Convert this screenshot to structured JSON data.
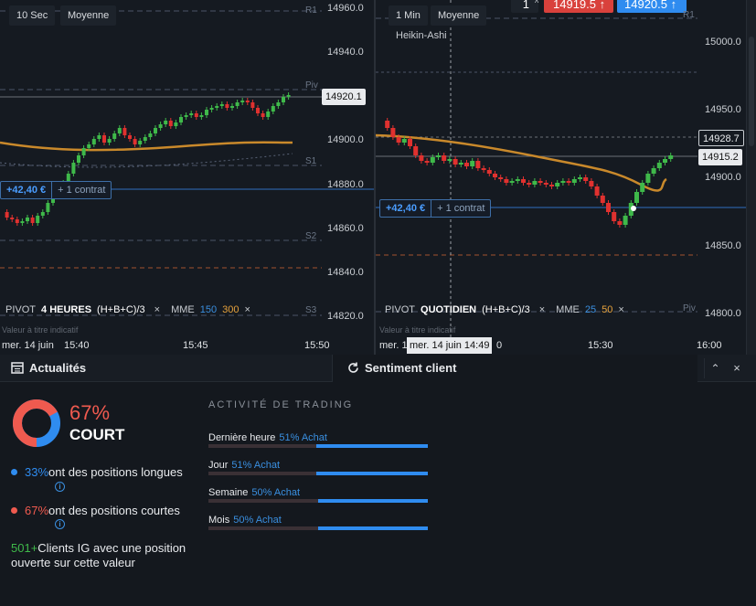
{
  "left_chart": {
    "interval": "10 Sec",
    "type": "Moyenne",
    "price_axis": [
      "14960.0",
      "14940.0",
      "14920.1",
      "14900.0",
      "14880.0",
      "14860.0",
      "14840.0",
      "14820.0"
    ],
    "current_price": "14920.1",
    "levels": {
      "r1": "R1",
      "piv": "Piv",
      "s1": "S1",
      "s2": "S2",
      "s3": "S3"
    },
    "position": {
      "pnl": "+42,40 €",
      "contracts": "+ 1 contrat"
    },
    "indicator_bar": {
      "pivot": "PIVOT",
      "period": "4 HEURES",
      "formula": "(H+B+C)/3",
      "mme": "MME",
      "mme_a": "150",
      "mme_b": "300",
      "close": "×"
    },
    "note": "Valeur à titre indicatif",
    "time_axis": [
      "mer. 14 juin",
      "15:40",
      "15:45",
      "15:50"
    ]
  },
  "right_chart": {
    "interval": "1 Min",
    "type": "Moyenne",
    "style": "Heikin-Ashi",
    "quantity": "1",
    "sell_price": "14919.5",
    "buy_price": "14920.5",
    "arrow": "↑",
    "price_axis": [
      "15000.0",
      "14950.0",
      "14928.7",
      "14915.2",
      "14900.0",
      "14850.0",
      "14800.0"
    ],
    "levels": {
      "r1": "R1",
      "piv": "Piv"
    },
    "position": {
      "pnl": "+42,40 €",
      "contracts": "+ 1 contrat"
    },
    "indicator_bar": {
      "pivot": "PIVOT",
      "period": "QUOTIDIEN",
      "formula": "(H+B+C)/3",
      "mme": "MME",
      "mme_a": "25",
      "mme_b": "50",
      "close": "×"
    },
    "note": "Valeur à titre indicatif",
    "time_axis": [
      "mer. 1",
      "mer. 14 juin 14:49",
      "0",
      "15:30",
      "16:00"
    ]
  },
  "tabs": {
    "news": "Actualités",
    "sentiment": "Sentiment client"
  },
  "sentiment": {
    "percent": "67%",
    "direction": "COURT",
    "long_pct": "33%",
    "long_text": "ont des positions longues",
    "short_pct": "67%",
    "short_text": "ont des positions courtes",
    "clients_count": "501+",
    "clients_text_1": "Clients IG avec une position",
    "clients_text_2": "ouverte sur cette valeur",
    "short_fraction": 0.67
  },
  "activity": {
    "title": "ACTIVITÉ DE TRADING",
    "rows": [
      {
        "label": "Dernière heure",
        "value": "51% Achat",
        "fraction": 0.51
      },
      {
        "label": "Jour",
        "value": "51% Achat",
        "fraction": 0.51
      },
      {
        "label": "Semaine",
        "value": "50% Achat",
        "fraction": 0.5
      },
      {
        "label": "Mois",
        "value": "50% Achat",
        "fraction": 0.5
      }
    ]
  },
  "colors": {
    "up": "#3fb94a",
    "down": "#e0312f",
    "accent": "#2f8cf0",
    "mme": "#c9892b",
    "short": "#ef5a4f"
  }
}
